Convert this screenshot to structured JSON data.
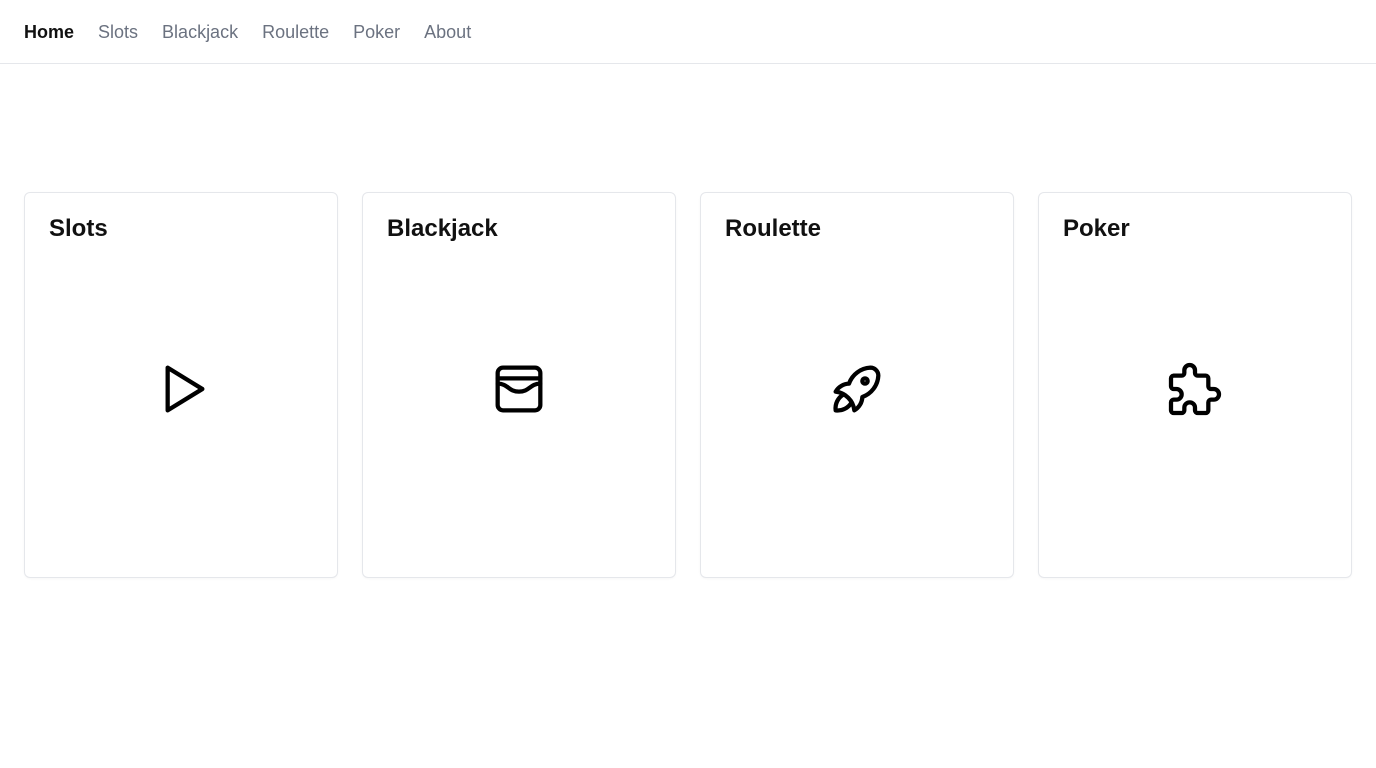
{
  "nav": {
    "items": [
      {
        "label": "Home",
        "active": true
      },
      {
        "label": "Slots",
        "active": false
      },
      {
        "label": "Blackjack",
        "active": false
      },
      {
        "label": "Roulette",
        "active": false
      },
      {
        "label": "Poker",
        "active": false
      },
      {
        "label": "About",
        "active": false
      }
    ]
  },
  "cards": [
    {
      "title": "Slots",
      "icon": "play-icon"
    },
    {
      "title": "Blackjack",
      "icon": "wallet-icon"
    },
    {
      "title": "Roulette",
      "icon": "rocket-icon"
    },
    {
      "title": "Poker",
      "icon": "puzzle-icon"
    }
  ],
  "colors": {
    "text_primary": "#111111",
    "text_muted": "#6b7280",
    "border": "#e5e7eb",
    "background": "#ffffff"
  }
}
